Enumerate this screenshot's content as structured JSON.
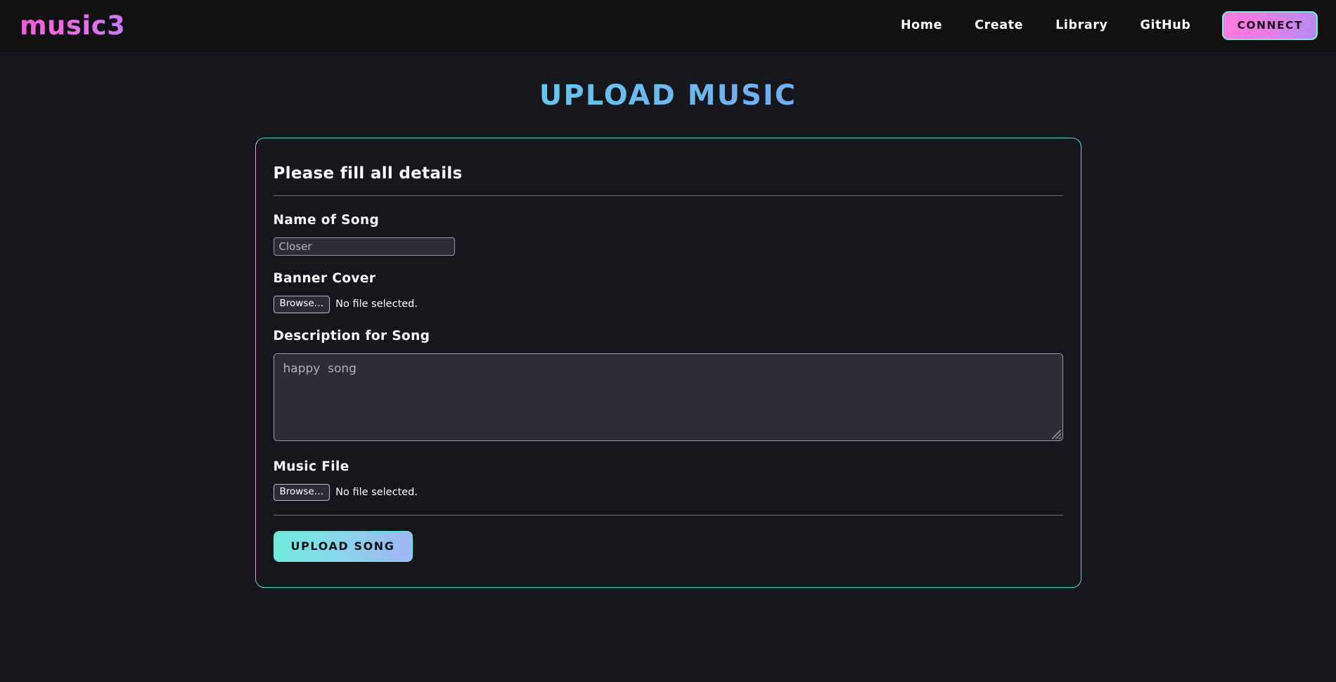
{
  "header": {
    "brand": "music3",
    "nav": [
      {
        "label": "Home"
      },
      {
        "label": "Create"
      },
      {
        "label": "Library"
      },
      {
        "label": "GitHub"
      }
    ],
    "connect_label": "CONNECT",
    "brand_gradient_from": "#f558d8",
    "brand_gradient_to": "#c77bf5",
    "connect_border_color": "#7fe9e0"
  },
  "page": {
    "title": "UPLOAD MUSIC",
    "title_gradient_from": "#5ce0e0",
    "title_gradient_to": "#a7a6fa",
    "background": "#16171d"
  },
  "card": {
    "border_color": "#6fd5d2",
    "heading": "Please fill all details",
    "fields": {
      "song_name": {
        "label": "Name of Song",
        "value": "",
        "placeholder": "Closer"
      },
      "banner_cover": {
        "label": "Banner Cover",
        "browse_label": "Browse…",
        "file_status": "No file selected."
      },
      "description": {
        "label": "Description for Song",
        "value": "",
        "placeholder": "happy  song"
      },
      "music_file": {
        "label": "Music File",
        "browse_label": "Browse…",
        "file_status": "No file selected."
      }
    },
    "submit_label": "UPLOAD SONG",
    "submit_gradient_from": "#6ee9da",
    "submit_gradient_to": "#a3b4f5"
  }
}
